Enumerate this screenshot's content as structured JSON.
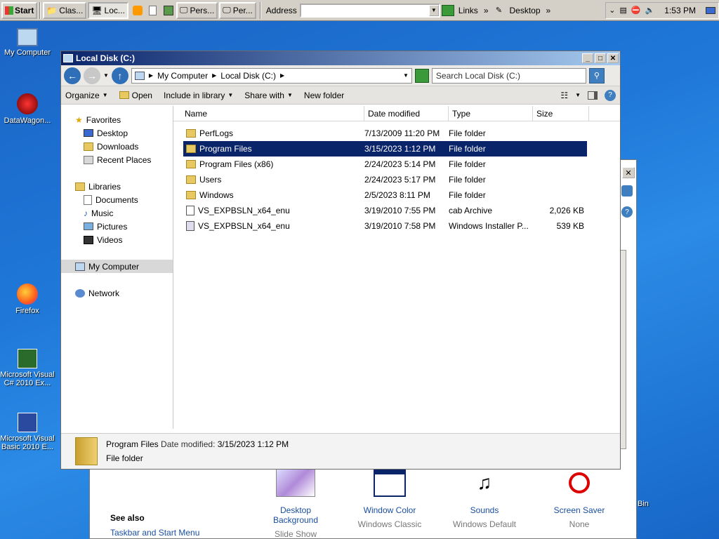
{
  "taskbar": {
    "start_label": "Start",
    "tasks": [
      {
        "label": "Clas...",
        "active": false
      },
      {
        "label": "Loc...",
        "active": true
      },
      {
        "label": "Pers...",
        "active": false
      },
      {
        "label": "Per...",
        "active": false
      }
    ],
    "address_label": "Address",
    "links_label": "Links",
    "desktop_label": "Desktop",
    "clock": "1:53 PM"
  },
  "desktop_icons": [
    {
      "label": "My Computer"
    },
    {
      "label": "DataWagon..."
    },
    {
      "label": "Firefox"
    },
    {
      "label": "Microsoft Visual C# 2010 Ex..."
    },
    {
      "label": "Microsoft Visual Basic 2010 E..."
    }
  ],
  "explorer": {
    "title": "Local Disk (C:)",
    "breadcrumb": [
      "My Computer",
      "Local Disk (C:)"
    ],
    "search_placeholder": "Search Local Disk (C:)",
    "commands": {
      "organize": "Organize",
      "open": "Open",
      "include": "Include in library",
      "share": "Share with",
      "new_folder": "New folder"
    },
    "nav": {
      "favorites": "Favorites",
      "desktop": "Desktop",
      "downloads": "Downloads",
      "recent": "Recent Places",
      "libraries": "Libraries",
      "documents": "Documents",
      "music": "Music",
      "pictures": "Pictures",
      "videos": "Videos",
      "my_computer": "My Computer",
      "network": "Network"
    },
    "columns": {
      "name": "Name",
      "date": "Date modified",
      "type": "Type",
      "size": "Size"
    },
    "files": [
      {
        "name": "PerfLogs",
        "date": "7/13/2009 11:20 PM",
        "type": "File folder",
        "size": ""
      },
      {
        "name": "Program Files",
        "date": "3/15/2023 1:12 PM",
        "type": "File folder",
        "size": ""
      },
      {
        "name": "Program Files (x86)",
        "date": "2/24/2023 5:14 PM",
        "type": "File folder",
        "size": ""
      },
      {
        "name": "Users",
        "date": "2/24/2023 5:17 PM",
        "type": "File folder",
        "size": ""
      },
      {
        "name": "Windows",
        "date": "2/5/2023 8:11 PM",
        "type": "File folder",
        "size": ""
      },
      {
        "name": "VS_EXPBSLN_x64_enu",
        "date": "3/19/2010 7:55 PM",
        "type": "cab Archive",
        "size": "2,026 KB"
      },
      {
        "name": "VS_EXPBSLN_x64_enu",
        "date": "3/19/2010 7:58 PM",
        "type": "Windows Installer P...",
        "size": "539 KB"
      }
    ],
    "details": {
      "name": "Program Files",
      "date_label": "Date modified:",
      "date": "3/15/2023 1:12 PM",
      "type": "File folder"
    }
  },
  "background_window": {
    "see_also": "See also",
    "taskbar_link": "Taskbar and Start Menu",
    "bin_label": "Bin",
    "items": [
      {
        "title": "Desktop Background",
        "sub": "Slide Show"
      },
      {
        "title": "Window Color",
        "sub": "Windows Classic"
      },
      {
        "title": "Sounds",
        "sub": "Windows Default"
      },
      {
        "title": "Screen Saver",
        "sub": "None"
      }
    ]
  }
}
